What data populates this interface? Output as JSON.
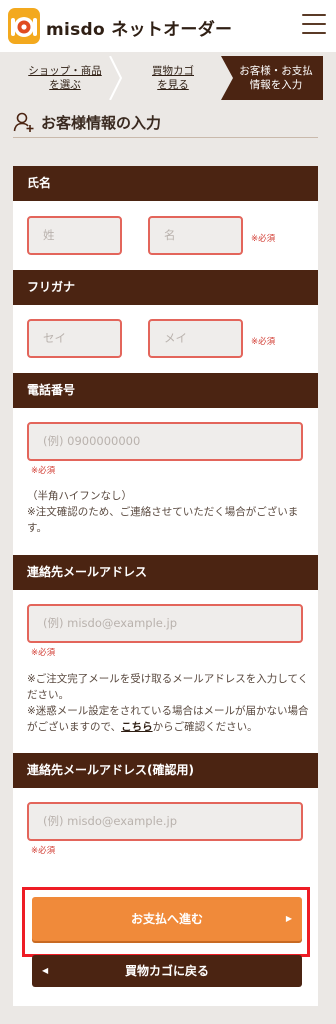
{
  "header": {
    "brand": "misdo ネットオーダー"
  },
  "steps": [
    {
      "label_line1": "ショップ・商品",
      "label_line2": "を選ぶ"
    },
    {
      "label_line1": "買物カゴ",
      "label_line2": "を見る"
    },
    {
      "label_line1": "お客様・お支払",
      "label_line2": "情報を入力"
    }
  ],
  "page": {
    "title": "お客様情報の入力"
  },
  "form": {
    "name": {
      "heading": "氏名",
      "last_placeholder": "姓",
      "first_placeholder": "名",
      "required": "※必須"
    },
    "kana": {
      "heading": "フリガナ",
      "last_placeholder": "セイ",
      "first_placeholder": "メイ",
      "required": "※必須"
    },
    "phone": {
      "heading": "電話番号",
      "placeholder": "(例) 0900000000",
      "required": "※必須",
      "note_line1": "（半角ハイフンなし）",
      "note_line2": "※注文確認のため、ご連絡させていただく場合がございます。"
    },
    "email": {
      "heading": "連絡先メールアドレス",
      "placeholder": "(例) misdo@example.jp",
      "required": "※必須",
      "note_line1": "※ご注文完了メールを受け取るメールアドレスを入力してください。",
      "note_line2_pre": "※迷惑メール設定をされている場合はメールが届かない場合がございますので、",
      "note_link": "こちら",
      "note_line2_post": "からご確認ください。"
    },
    "email_confirm": {
      "heading": "連絡先メールアドレス(確認用)",
      "placeholder": "(例) misdo@example.jp",
      "required": "※必須"
    }
  },
  "buttons": {
    "next": "お支払へ進む",
    "back": "買物カゴに戻る"
  },
  "colors": {
    "brown": "#4b2412",
    "orange": "#f08a3a",
    "required_red": "#d23c33",
    "input_border": "#e3655b",
    "highlight_red": "#ee1c25"
  }
}
